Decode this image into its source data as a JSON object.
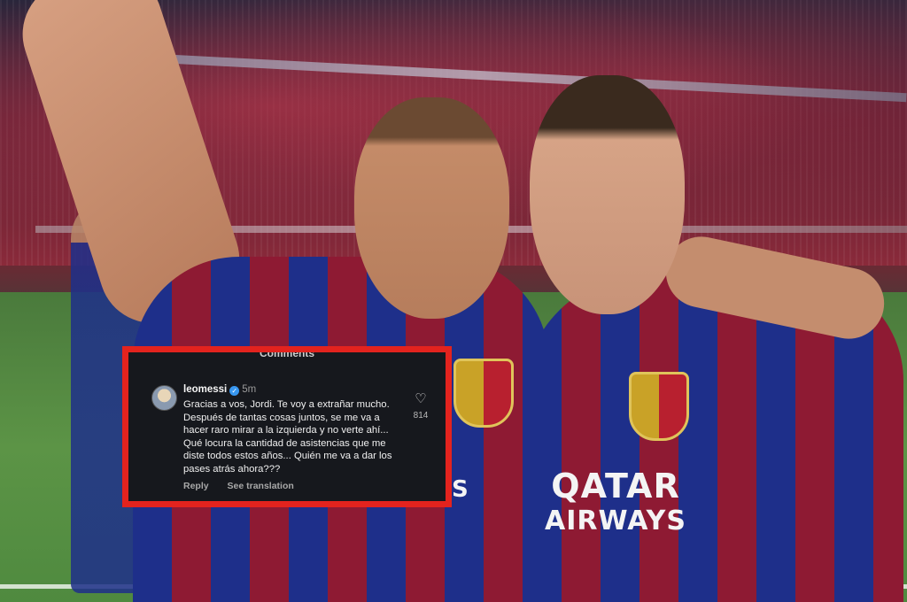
{
  "comments_panel": {
    "header": "Comments",
    "comment": {
      "avatar_icon": "avatar-image",
      "username": "leomessi",
      "verified_icon": "verified-badge-icon",
      "time": "5m",
      "text": "Gracias a vos, Jordi. Te voy a extrañar mucho. Después de tantas cosas juntos, se me va a hacer raro mirar a la izquierda y no verte ahí... Qué locura la cantidad de asistencias que me diste todos estos años... Quién me va a dar los pases atrás ahora???",
      "like_icon": "heart-icon",
      "like_count": "814",
      "reply_label": "Reply",
      "see_translation_label": "See translation"
    },
    "highlight_border_color": "#e3231e"
  },
  "photo": {
    "shirt_sponsor_line1": "QATAR",
    "shirt_sponsor_line2": "AIRWAYS",
    "shirt_sponsor_left": "AIRWAYS"
  }
}
